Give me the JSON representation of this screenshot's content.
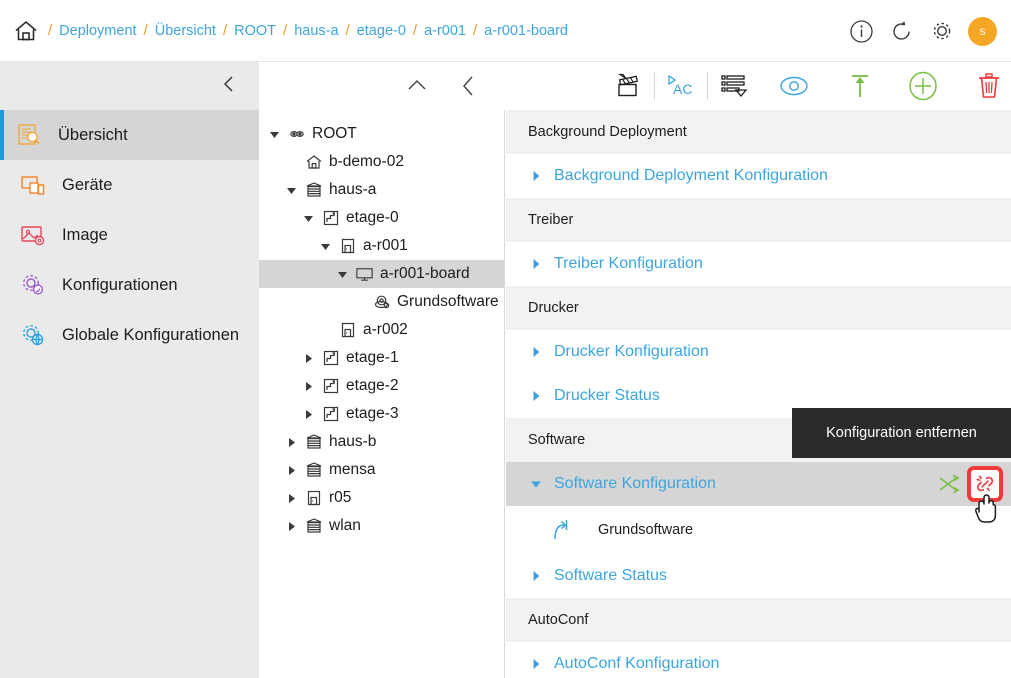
{
  "breadcrumb": {
    "home_icon": "home-icon",
    "separator": "/",
    "items": [
      "Deployment",
      "Übersicht",
      "ROOT",
      "haus-a",
      "etage-0",
      "a-r001",
      "a-r001-board"
    ]
  },
  "header_actions": {
    "info_icon": "info-icon",
    "refresh_icon": "refresh-icon",
    "settings_icon": "gear-icon",
    "avatar_label": "s",
    "avatar_color": "#f5a623"
  },
  "sidebar": {
    "collapse_icon": "chevron-left-icon",
    "items": [
      {
        "label": "Übersicht",
        "icon": "document-search-icon",
        "color": "#f0a83c",
        "active": true
      },
      {
        "label": "Geräte",
        "icon": "devices-icon",
        "color": "#f2842a",
        "active": false
      },
      {
        "label": "Image",
        "icon": "image-gear-icon",
        "color": "#e8445a",
        "active": false
      },
      {
        "label": "Konfigurationen",
        "icon": "gear-search-icon",
        "color": "#9b59d0",
        "active": false
      },
      {
        "label": "Globale Konfigurationen",
        "icon": "gear-globe-icon",
        "color": "#2aa3e0",
        "active": false
      }
    ]
  },
  "tree": [
    {
      "label": "ROOT",
      "icon": "root-icon",
      "depth": 0,
      "arrow": "down",
      "selected": false
    },
    {
      "label": "b-demo-02",
      "icon": "house-icon",
      "depth": 1,
      "arrow": "none",
      "selected": false
    },
    {
      "label": "haus-a",
      "icon": "building-icon",
      "depth": 1,
      "arrow": "down",
      "selected": false
    },
    {
      "label": "etage-0",
      "icon": "floor-icon",
      "depth": 2,
      "arrow": "down",
      "selected": false
    },
    {
      "label": "a-r001",
      "icon": "room-icon",
      "depth": 3,
      "arrow": "down",
      "selected": false
    },
    {
      "label": "a-r001-board",
      "icon": "monitor-icon",
      "depth": 4,
      "arrow": "down",
      "selected": true
    },
    {
      "label": "Grundsoftware",
      "icon": "software-icon",
      "depth": 5,
      "arrow": "none",
      "selected": false
    },
    {
      "label": "a-r002",
      "icon": "room-icon",
      "depth": 3,
      "arrow": "none",
      "selected": false
    },
    {
      "label": "etage-1",
      "icon": "floor-icon",
      "depth": 2,
      "arrow": "right",
      "selected": false
    },
    {
      "label": "etage-2",
      "icon": "floor-icon",
      "depth": 2,
      "arrow": "right",
      "selected": false
    },
    {
      "label": "etage-3",
      "icon": "floor-icon",
      "depth": 2,
      "arrow": "right",
      "selected": false
    },
    {
      "label": "haus-b",
      "icon": "building-icon",
      "depth": 1,
      "arrow": "right",
      "selected": false
    },
    {
      "label": "mensa",
      "icon": "building-icon",
      "depth": 1,
      "arrow": "right",
      "selected": false
    },
    {
      "label": "r05",
      "icon": "room-icon",
      "depth": 1,
      "arrow": "right",
      "selected": false
    },
    {
      "label": "wlan",
      "icon": "building-icon",
      "depth": 1,
      "arrow": "right",
      "selected": false
    }
  ],
  "toolbar": {
    "buttons": [
      {
        "name": "collapse-up-button",
        "icon": "chevron-up-icon",
        "color": "#444444"
      },
      {
        "name": "back-button",
        "icon": "chevron-left-icon",
        "color": "#444444"
      },
      {
        "name": "clapperboard-button",
        "icon": "clapperboard-icon",
        "color": "#1d1d1d"
      },
      {
        "name": "autoconf-button",
        "icon": "ac-icon",
        "color": "#3ca5e0"
      },
      {
        "name": "list-button",
        "icon": "list-filter-icon",
        "color": "#1d1d1d"
      },
      {
        "name": "preview-button",
        "icon": "eye-icon",
        "color": "#3ca5e0"
      },
      {
        "name": "upload-button",
        "icon": "arrow-up-icon",
        "color": "#78c043"
      },
      {
        "name": "add-button",
        "icon": "plus-circle-icon",
        "color": "#78c043"
      },
      {
        "name": "delete-button",
        "icon": "trash-icon",
        "color": "#ef3b3b"
      }
    ]
  },
  "content": {
    "sections": [
      {
        "header": "Background Deployment",
        "rows": [
          {
            "label": "Background Deployment Konfiguration",
            "expanded": false,
            "actions": false
          }
        ]
      },
      {
        "header": "Treiber",
        "rows": [
          {
            "label": "Treiber Konfiguration",
            "expanded": false,
            "actions": false
          }
        ]
      },
      {
        "header": "Drucker",
        "rows": [
          {
            "label": "Drucker Konfiguration",
            "expanded": false,
            "actions": false
          },
          {
            "label": "Drucker Status",
            "expanded": false,
            "actions": false
          }
        ]
      },
      {
        "header": "Software",
        "rows": [
          {
            "label": "Software Konfiguration",
            "expanded": true,
            "actions": true,
            "children": [
              {
                "label": "Grundsoftware",
                "icon": "inherited-arrow-icon"
              }
            ]
          },
          {
            "label": "Software Status",
            "expanded": false,
            "actions": false
          }
        ]
      },
      {
        "header": "AutoConf",
        "rows": [
          {
            "label": "AutoConf Konfiguration",
            "expanded": false,
            "actions": false
          }
        ]
      }
    ],
    "row_actions": {
      "shuffle": {
        "name": "shuffle-icon",
        "color": "#78c043"
      },
      "unlink": {
        "name": "broken-link-icon",
        "color": "#ef3b3b",
        "highlighted": true
      }
    }
  },
  "tooltip": {
    "text": "Konfiguration entfernen",
    "background": "#2b2b2b"
  },
  "colors": {
    "link": "#3ca5e0",
    "accent_orange": "#f29a2e",
    "section_header_bg": "#f2f2f2",
    "selected_row_bg": "#d5d5d5",
    "sidebar_bg": "#eaeaea"
  }
}
